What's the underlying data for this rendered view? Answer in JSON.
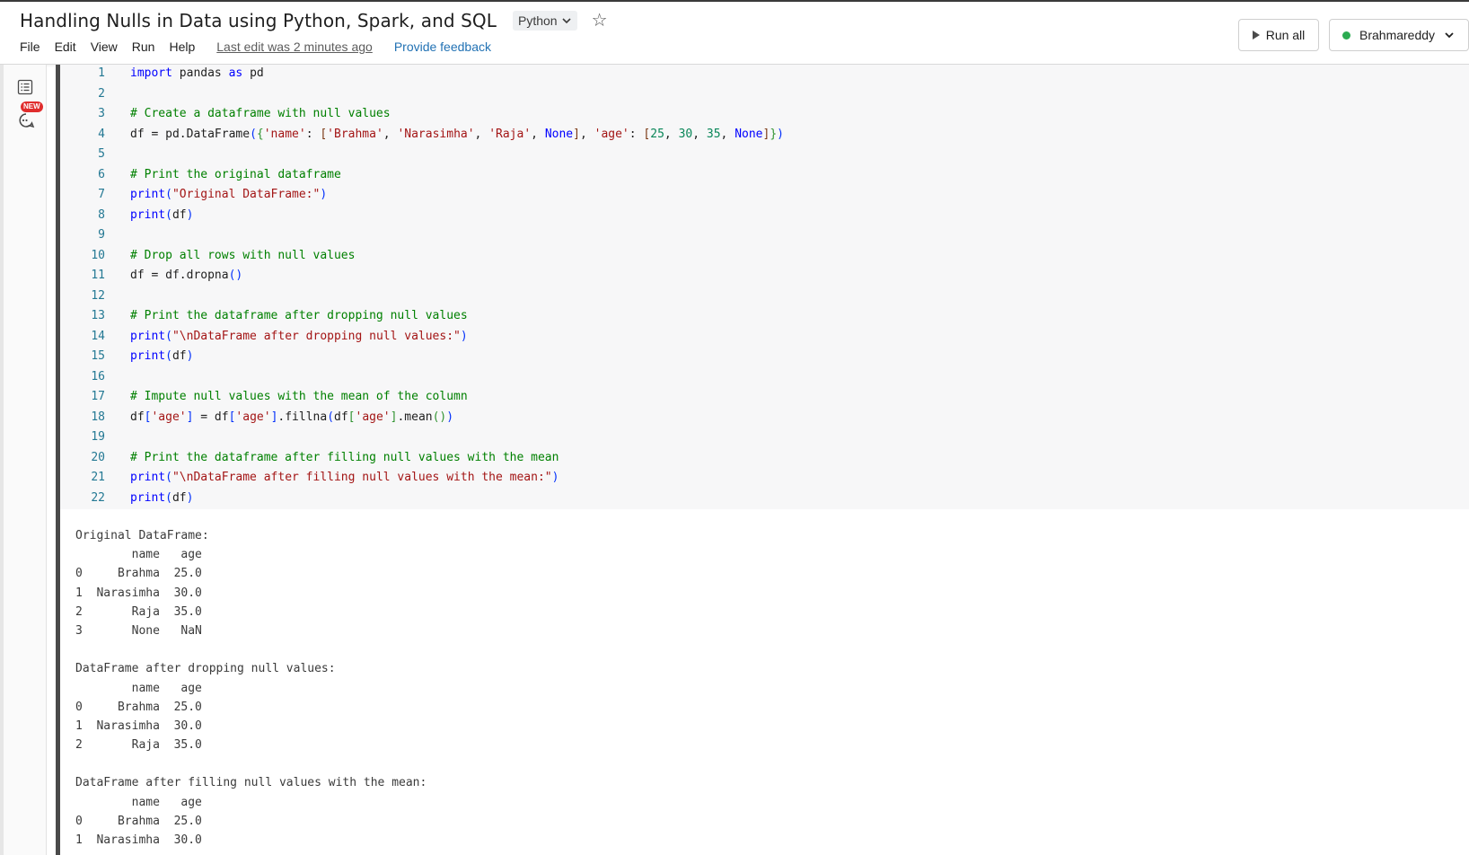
{
  "header": {
    "title": "Handling Nulls in Data using Python, Spark, and SQL",
    "language": "Python",
    "menu": [
      "File",
      "Edit",
      "View",
      "Run",
      "Help"
    ],
    "last_edit": "Last edit was 2 minutes ago",
    "feedback": "Provide feedback",
    "run_all": "Run all",
    "cluster": "Brahmareddy",
    "cluster_status_color": "#2bab51"
  },
  "rail": {
    "new_badge": "NEW",
    "icons": [
      "table-of-contents-icon",
      "assistant-icon"
    ]
  },
  "code": {
    "lines": [
      "import pandas as pd",
      "",
      "# Create a dataframe with null values",
      "df = pd.DataFrame({'name': ['Brahma', 'Narasimha', 'Raja', None], 'age': [25, 30, 35, None]})",
      "",
      "# Print the original dataframe",
      "print(\"Original DataFrame:\")",
      "print(df)",
      "",
      "# Drop all rows with null values",
      "df = df.dropna()",
      "",
      "# Print the dataframe after dropping null values",
      "print(\"\\nDataFrame after dropping null values:\")",
      "print(df)",
      "",
      "# Impute null values with the mean of the column",
      "df['age'] = df['age'].fillna(df['age'].mean())",
      "",
      "# Print the dataframe after filling null values with the mean",
      "print(\"\\nDataFrame after filling null values with the mean:\")",
      "print(df)"
    ]
  },
  "output": {
    "lines": [
      "Original DataFrame:",
      "        name   age",
      "0     Brahma  25.0",
      "1  Narasimha  30.0",
      "2       Raja  35.0",
      "3       None   NaN",
      "",
      "DataFrame after dropping null values:",
      "        name   age",
      "0     Brahma  25.0",
      "1  Narasimha  30.0",
      "2       Raja  35.0",
      "",
      "DataFrame after filling null values with the mean:",
      "        name   age",
      "0     Brahma  25.0",
      "1  Narasimha  30.0"
    ]
  }
}
